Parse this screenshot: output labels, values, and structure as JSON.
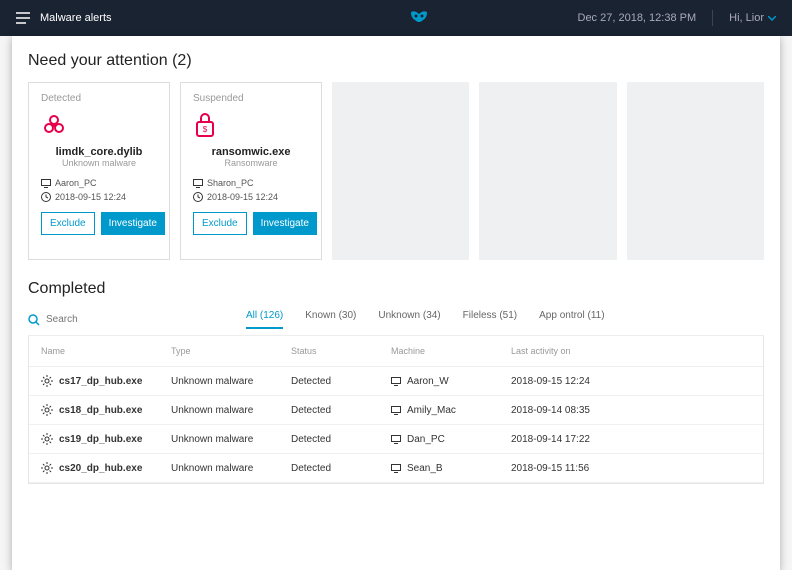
{
  "topbar": {
    "title": "Malware alerts",
    "datetime": "Dec 27, 2018, 12:38 PM",
    "greeting": "Hi, Lior"
  },
  "attention": {
    "title": "Need your attention (2)",
    "cards": [
      {
        "status": "Detected",
        "name": "limdk_core.dylib",
        "subtitle": "Unknown malware",
        "machine": "Aaron_PC",
        "timestamp": "2018-09-15   12:24",
        "exclude": "Exclude",
        "investigate": "Investigate",
        "icon": "biohazard"
      },
      {
        "status": "Suspended",
        "name": "ransomwic.exe",
        "subtitle": "Ransomware",
        "machine": "Sharon_PC",
        "timestamp": "2018-09-15   12:24",
        "exclude": "Exclude",
        "investigate": "Investigate",
        "icon": "lock"
      }
    ]
  },
  "completed": {
    "title": "Completed",
    "search_placeholder": "Search",
    "tabs": [
      {
        "label": "All (126)"
      },
      {
        "label": "Known (30)"
      },
      {
        "label": "Unknown (34)"
      },
      {
        "label": "Fileless (51)"
      },
      {
        "label": "App ontrol (11)"
      }
    ],
    "columns": {
      "name": "Name",
      "type": "Type",
      "status": "Status",
      "machine": "Machine",
      "activity": "Last activity on"
    },
    "rows": [
      {
        "name": "cs17_dp_hub.exe",
        "type": "Unknown malware",
        "status": "Detected",
        "machine": "Aaron_W",
        "activity": "2018-09-15   12:24"
      },
      {
        "name": "cs18_dp_hub.exe",
        "type": "Unknown malware",
        "status": "Detected",
        "machine": "Amily_Mac",
        "activity": "2018-09-14   08:35"
      },
      {
        "name": "cs19_dp_hub.exe",
        "type": "Unknown malware",
        "status": "Detected",
        "machine": "Dan_PC",
        "activity": "2018-09-14   17:22"
      },
      {
        "name": "cs20_dp_hub.exe",
        "type": "Unknown malware",
        "status": "Detected",
        "machine": "Sean_B",
        "activity": "2018-09-15   11:56"
      }
    ]
  }
}
